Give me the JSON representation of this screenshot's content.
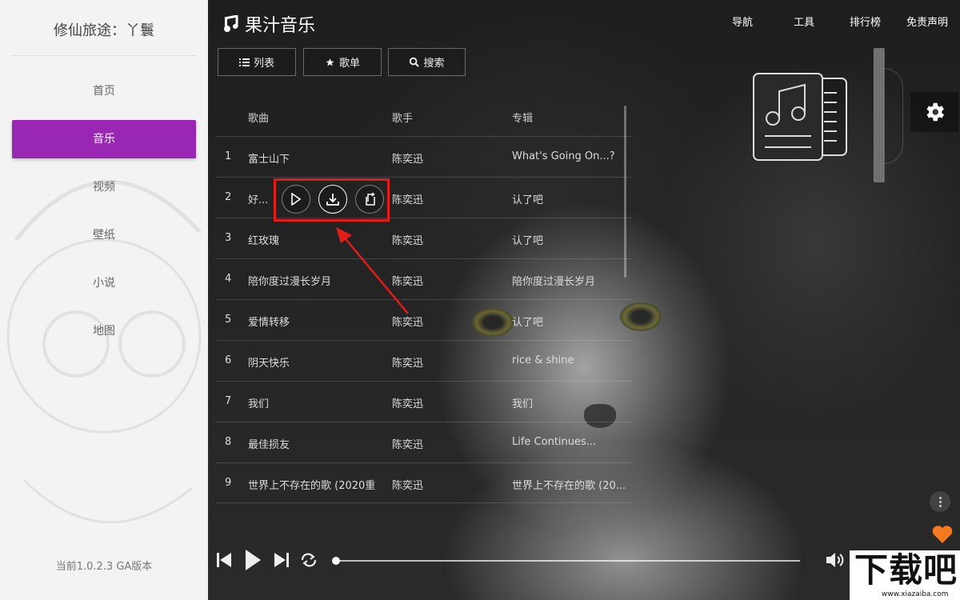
{
  "sidebar": {
    "title": "修仙旅途：丫鬟",
    "items": [
      {
        "label": "首页",
        "active": false
      },
      {
        "label": "音乐",
        "active": true
      },
      {
        "label": "视频",
        "active": false
      },
      {
        "label": "壁纸",
        "active": false
      },
      {
        "label": "小说",
        "active": false
      },
      {
        "label": "地图",
        "active": false
      }
    ],
    "version": "当前1.0.2.3 GA版本",
    "active_color": "#9927b4"
  },
  "header": {
    "app_name": "果汁音乐",
    "nav": [
      "导航",
      "工具",
      "排行榜",
      "免责声明"
    ]
  },
  "tabs": [
    {
      "label": "列表",
      "icon": "list-icon"
    },
    {
      "label": "歌单",
      "icon": "star-icon"
    },
    {
      "label": "搜索",
      "icon": "search-icon"
    }
  ],
  "table": {
    "columns": [
      "歌曲",
      "歌手",
      "专辑"
    ],
    "rows": [
      {
        "num": "1",
        "title": "富士山下",
        "artist": "陈奕迅",
        "album": "What's Going On...?"
      },
      {
        "num": "2",
        "title": "好...",
        "artist": "陈奕迅",
        "album": "认了吧"
      },
      {
        "num": "3",
        "title": "红玫瑰",
        "artist": "陈奕迅",
        "album": "认了吧"
      },
      {
        "num": "4",
        "title": "陪你度过漫长岁月",
        "artist": "陈奕迅",
        "album": "陪你度过漫长岁月"
      },
      {
        "num": "5",
        "title": "爱情转移",
        "artist": "陈奕迅",
        "album": "认了吧"
      },
      {
        "num": "6",
        "title": "阴天快乐",
        "artist": "陈奕迅",
        "album": "rice & shine"
      },
      {
        "num": "7",
        "title": "我们",
        "artist": "陈奕迅",
        "album": "我们"
      },
      {
        "num": "8",
        "title": "最佳损友",
        "artist": "陈奕迅",
        "album": "Life Continues..."
      },
      {
        "num": "9",
        "title": "世界上不存在的歌 (2020重",
        "artist": "陈奕迅",
        "album": "世界上不存在的歌 (20..."
      }
    ]
  },
  "row_actions": [
    "play-icon",
    "download-icon",
    "share-icon"
  ],
  "player": {
    "progress": 0,
    "icons": [
      "previous-icon",
      "play-icon",
      "next-icon",
      "repeat-icon",
      "volume-icon"
    ]
  },
  "annotation_color": "#e21b1b",
  "heart_color": "#f47a20",
  "watermark": {
    "big": "下载吧",
    "small": "www.xiazaiba.com"
  }
}
